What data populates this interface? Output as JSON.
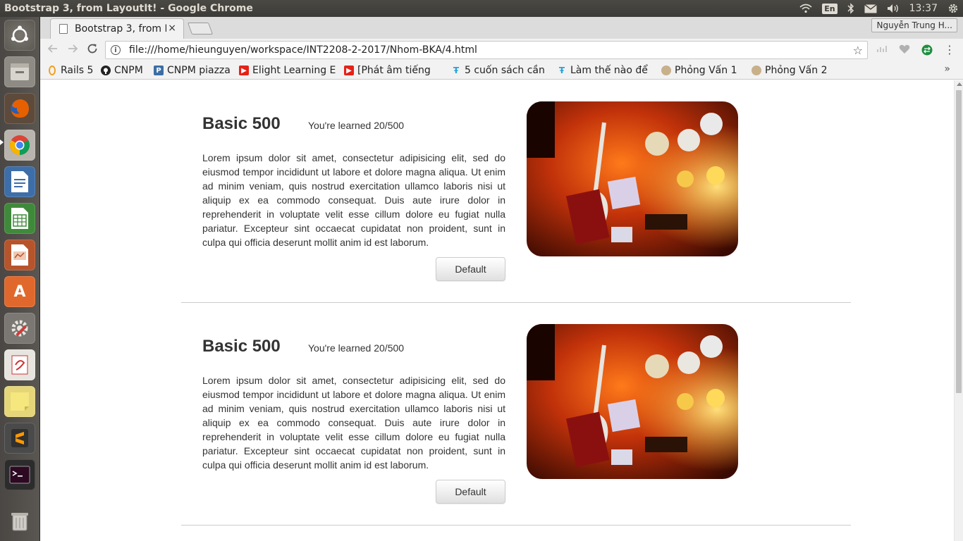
{
  "os": {
    "window_title": "Bootstrap 3, from LayoutIt! - Google Chrome",
    "lang_indicator": "En",
    "clock": "13:37"
  },
  "launcher": {
    "items": [
      {
        "name": "dash-icon"
      },
      {
        "name": "files-icon"
      },
      {
        "name": "firefox-icon"
      },
      {
        "name": "chrome-icon"
      },
      {
        "name": "writer-icon"
      },
      {
        "name": "calc-icon"
      },
      {
        "name": "impress-icon"
      },
      {
        "name": "software-center-icon"
      },
      {
        "name": "settings-icon"
      },
      {
        "name": "reader-icon"
      },
      {
        "name": "notes-icon"
      },
      {
        "name": "sublime-icon"
      },
      {
        "name": "terminal-icon"
      },
      {
        "name": "trash-icon"
      }
    ]
  },
  "browser": {
    "tab_title": "Bootstrap 3, from LayoutIt!",
    "tab_close": "×",
    "profile_name": "Nguyễn Trung H...",
    "url": "file:///home/hieunguyen/workspace/INT2208-2-2017/Nhom-BKA/4.html",
    "bookmarks": [
      {
        "label": "Rails 5",
        "icon_color": "#f0a020"
      },
      {
        "label": "CNPM",
        "icon_color": "#222222"
      },
      {
        "label": "CNPM piazza",
        "icon_color": "#3b6ea5"
      },
      {
        "label": "Elight Learning E",
        "icon_color": "#e62117"
      },
      {
        "label": "[Phát âm tiếng",
        "icon_color": "#e62117"
      },
      {
        "label": "5 cuốn sách cần",
        "icon_color": "#2ba3d8"
      },
      {
        "label": "Làm thế nào để",
        "icon_color": "#2ba3d8"
      },
      {
        "label": "Phỏng Vấn 1",
        "icon_color": "#c8b08a"
      },
      {
        "label": "Phỏng Vấn 2",
        "icon_color": "#c8b08a"
      }
    ],
    "more_bookmarks": "»"
  },
  "page": {
    "cards": [
      {
        "heading": "Basic 500",
        "progress_text": "You're learned 20/500",
        "body": "Lorem ipsum dolor sit amet, consectetur adipisicing elit, sed do eiusmod tempor incididunt ut labore et dolore magna aliqua. Ut enim ad minim veniam, quis nostrud exercitation ullamco laboris nisi ut aliquip ex ea commodo consequat. Duis aute irure dolor in reprehenderit in voluptate velit esse cillum dolore eu fugiat nulla pariatur. Excepteur sint occaecat cupidatat non proident, sunt in culpa qui officia deserunt mollit anim id est laborum.",
        "button_label": "Default"
      },
      {
        "heading": "Basic 500",
        "progress_text": "You're learned 20/500",
        "body": "Lorem ipsum dolor sit amet, consectetur adipisicing elit, sed do eiusmod tempor incididunt ut labore et dolore magna aliqua. Ut enim ad minim veniam, quis nostrud exercitation ullamco laboris nisi ut aliquip ex ea commodo consequat. Duis aute irure dolor in reprehenderit in voluptate velit esse cillum dolore eu fugiat nulla pariatur. Excepteur sint occaecat cupidatat non proident, sunt in culpa qui officia deserunt mollit anim id est laborum.",
        "button_label": "Default"
      }
    ]
  }
}
